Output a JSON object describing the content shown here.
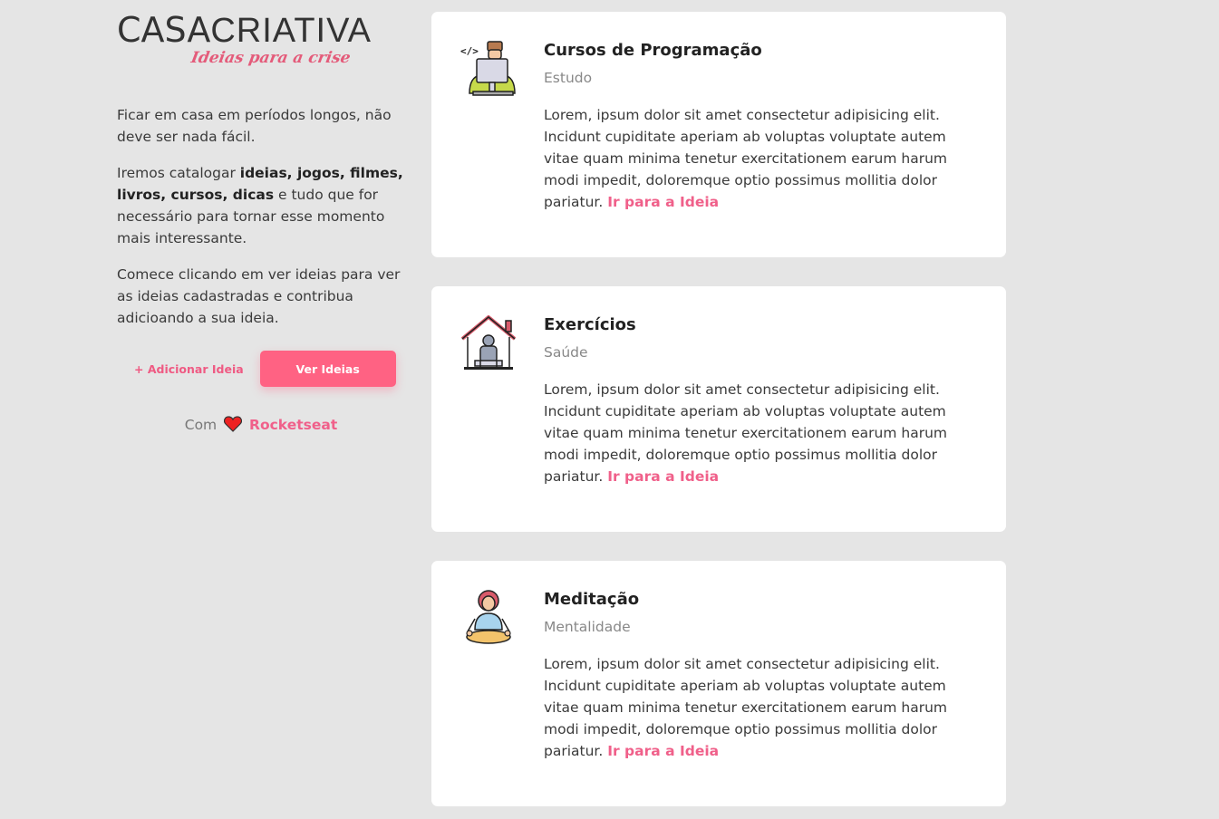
{
  "brand": {
    "name_bold": "CASA",
    "name_light": "CRIATIVA",
    "tagline": "Ideias para a crise"
  },
  "intro": {
    "p1": "Ficar em casa em períodos longos, não deve ser nada fácil.",
    "p2_prefix": "Iremos catalogar ",
    "p2_bold": "ideias, jogos, filmes, livros, cursos, dicas",
    "p2_suffix": " e tudo que for necessário para tornar esse momento mais interessante.",
    "p3": "Comece clicando em ver ideias para ver as ideias cadastradas e contribua adicioando a sua ideia."
  },
  "buttons": {
    "add_label": "+ Adicionar Ideia",
    "see_label": "Ver Ideias"
  },
  "credit": {
    "prefix": "Com",
    "heart_icon": "heart-icon",
    "brand": "Rocketseat"
  },
  "colors": {
    "accent": "#ff6283",
    "background": "#e5e5e5",
    "card": "#ffffff"
  },
  "ideas": [
    {
      "title": "Cursos de Programação",
      "category": "Estudo",
      "description": "Lorem, ipsum dolor sit amet consectetur adipisicing elit. Incidunt cupiditate aperiam ab voluptas voluptate autem vitae quam minima tenetur exercitationem earum harum modi impedit, doloremque optio possimus mollitia dolor pariatur.",
      "link_label": "Ir para a Ideia",
      "icon": "programmer-icon"
    },
    {
      "title": "Exercícios",
      "category": "Saúde",
      "description": "Lorem, ipsum dolor sit amet consectetur adipisicing elit. Incidunt cupiditate aperiam ab voluptas voluptate autem vitae quam minima tenetur exercitationem earum harum modi impedit, doloremque optio possimus mollitia dolor pariatur.",
      "link_label": "Ir para a Ideia",
      "icon": "home-workout-icon"
    },
    {
      "title": "Meditação",
      "category": "Mentalidade",
      "description": "Lorem, ipsum dolor sit amet consectetur adipisicing elit. Incidunt cupiditate aperiam ab voluptas voluptate autem vitae quam minima tenetur exercitationem earum harum modi impedit, doloremque optio possimus mollitia dolor pariatur.",
      "link_label": "Ir para a Ideia",
      "icon": "meditation-icon"
    }
  ]
}
